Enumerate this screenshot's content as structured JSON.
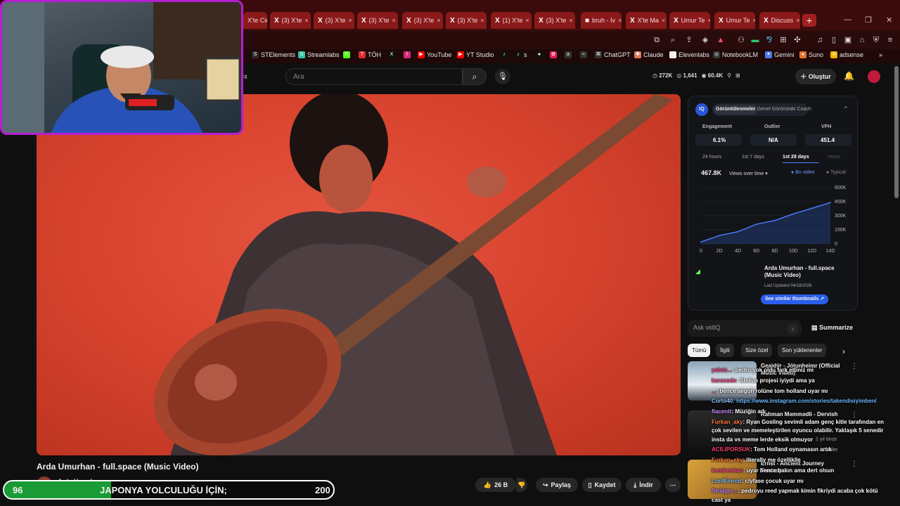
{
  "browser": {
    "tabs": [
      {
        "label": "X'te Cin",
        "icon": ""
      },
      {
        "label": "(3) X'te",
        "icon": "X"
      },
      {
        "label": "(3) X'te",
        "icon": "X"
      },
      {
        "label": "(3) X'te",
        "icon": "X"
      },
      {
        "label": "(3) X'te",
        "icon": "X"
      },
      {
        "label": "(3) X'te",
        "icon": "X"
      },
      {
        "label": "(1) X'te",
        "icon": "X"
      },
      {
        "label": "(3) X'te",
        "icon": "X"
      },
      {
        "label": "bruh - Iv",
        "icon": "■"
      },
      {
        "label": "X'te Ma",
        "icon": "X"
      },
      {
        "label": "Umur Te",
        "icon": "X"
      },
      {
        "label": "Umur Te",
        "icon": "X"
      },
      {
        "label": "Discuss",
        "icon": "X"
      }
    ],
    "new_tab": "+",
    "bookmarks": [
      {
        "label": "STElements",
        "icon": "S",
        "color": "#2b2b2b"
      },
      {
        "label": "Streamlabs",
        "icon": "S",
        "color": "#31c3a2"
      },
      {
        "label": "",
        "icon": "K",
        "color": "#53fc18"
      },
      {
        "label": "TÖH",
        "icon": "T",
        "color": "#e02a2a"
      },
      {
        "label": "",
        "icon": "X",
        "color": "#111"
      },
      {
        "label": "",
        "icon": "I",
        "color": "#d62976"
      },
      {
        "label": "YouTube",
        "icon": "▶",
        "color": "#ff0000"
      },
      {
        "label": "YT Studio",
        "icon": "▶",
        "color": "#ff0000"
      },
      {
        "label": "",
        "icon": "♪",
        "color": "#111"
      },
      {
        "label": "s",
        "icon": "♪",
        "color": "#111"
      },
      {
        "label": "",
        "icon": "●",
        "color": "#111"
      },
      {
        "label": "",
        "icon": "✿",
        "color": "#e01e5a"
      },
      {
        "label": "",
        "icon": "a",
        "color": "#333"
      },
      {
        "label": "",
        "icon": "≈",
        "color": "#333"
      },
      {
        "label": "ChatGPT",
        "icon": "⌘",
        "color": "#333"
      },
      {
        "label": "Claude",
        "icon": "✺",
        "color": "#d97757"
      },
      {
        "label": "Elevenlabs",
        "icon": "II",
        "color": "#eee"
      },
      {
        "label": "NotebookLM",
        "icon": "◎",
        "color": "#333"
      },
      {
        "label": "Gemini",
        "icon": "✦",
        "color": "#4b7bec"
      },
      {
        "label": "Suno",
        "icon": "●",
        "color": "#e0722b"
      },
      {
        "label": "adsense",
        "icon": "A",
        "color": "#f4b400"
      }
    ]
  },
  "youtube": {
    "search_placeholder": "Ara",
    "stats": [
      "272K",
      "1,641",
      "60.4K"
    ],
    "create_label": "Oluştur",
    "video_title": "Arda Umurhan - full.space (Music Video)",
    "channel_name": "Arda Umurhan",
    "actions": {
      "likes": "26 B",
      "share": "Paylaş",
      "save": "Kaydet",
      "download": "İndir"
    }
  },
  "vidiq": {
    "tabs": [
      "Görüntülenmeler",
      "Genel Görünüm",
      "AI Coach"
    ],
    "metrics": [
      {
        "label": "Engagement",
        "value": "6.1%"
      },
      {
        "label": "Outlier",
        "value": "N/A"
      },
      {
        "label": "VPH",
        "value": "451.4"
      }
    ],
    "ranges": [
      "24 hours",
      "1st 7 days",
      "1st 28 days",
      "Hepsi"
    ],
    "total_views": "467.8K",
    "views_mode": "Views over time",
    "legend": [
      "Bu video",
      "Typical"
    ],
    "video_title": "Arda Umurhan - full.space (Music Video)",
    "last_updated": "Last Updated 04/18/2026",
    "similar_button": "See similar thumbnails",
    "ask_placeholder": "Ask vidIQ",
    "summarize": "Summarize"
  },
  "chart_data": {
    "type": "line",
    "x": [
      "0",
      "2D",
      "4D",
      "6D",
      "8D",
      "10D",
      "12D",
      "14D"
    ],
    "y_ticks": [
      "600K",
      "450K",
      "300K",
      "150K",
      "0"
    ],
    "series": [
      {
        "name": "Bu video",
        "values": [
          20,
          90,
          130,
          210,
          250,
          320,
          380,
          440
        ]
      }
    ],
    "ylim": [
      0,
      600
    ],
    "unit_y": "K"
  },
  "sidebar": {
    "chips": [
      "Tümü",
      "İlgili",
      "Size özel",
      "Son yüklenenler"
    ],
    "recommended": [
      {
        "title": "Geaidýr - Jötunheimr (Official Music Video)",
        "meta": ""
      },
      {
        "title": "Rahman Məmmədli - Dervish",
        "meta": "1 yıl önce"
      },
      {
        "title": "Ernst - Ancient Journey Fantasy",
        "meta": "...enler"
      }
    ]
  },
  "chat": [
    {
      "user": "yalniz...",
      "text": ": pedro yok oldu fark ettiniz mi",
      "cls": "u"
    },
    {
      "user": "karacode",
      "text": ": Stelius projesi iyiydi ama ya",
      "cls": "u"
    },
    {
      "user": "...",
      "text": ": bence aegon rolüne tom holland uyar mı",
      "cls": "u5"
    },
    {
      "user": "Corto40",
      "text": ": https://www.instagram.com/stories/takendisiyimben/",
      "cls": "u2",
      "link": true
    },
    {
      "user": "flacentt",
      "text": ": Müziğin adı",
      "cls": "u3"
    },
    {
      "user": "Furkan_aky",
      "text": ": Ryan Gosling sevimli adam genç kitle tarafından en",
      "cls": "u4"
    },
    {
      "user": "",
      "text": "çok sevilen ve memeleştirilen oyuncu olabilir. Yaklaşık 5 senedir",
      "cls": ""
    },
    {
      "user": "",
      "text": "insta da vs meme lerde eksik olmuyor",
      "cls": ""
    },
    {
      "user": "ACILIPORSUK",
      "text": ": Tom Holland oynamasın artık",
      "cls": "u5"
    },
    {
      "user": "Furkan_aky",
      "text": ": literally me özelliklle",
      "cls": "u4"
    },
    {
      "user": "kemirenhan",
      "text": ": uyar bence bakın ama dert olsun",
      "cls": "u"
    },
    {
      "user": "LordFinrod",
      "text": ": clyfase çocuk uyar mı",
      "cls": "u2"
    },
    {
      "user": "Stridgre...",
      "text": ": pedroyu reed yapmak kimin fikriydi acaba çok kötü",
      "cls": "u3"
    },
    {
      "user": "",
      "text": "cast ya",
      "cls": ""
    }
  ],
  "poll": {
    "left_value": "96",
    "question": "JAPONYA YOLCULUĞU İÇİN;",
    "right_value": "200",
    "fill_fraction": 0.324
  }
}
